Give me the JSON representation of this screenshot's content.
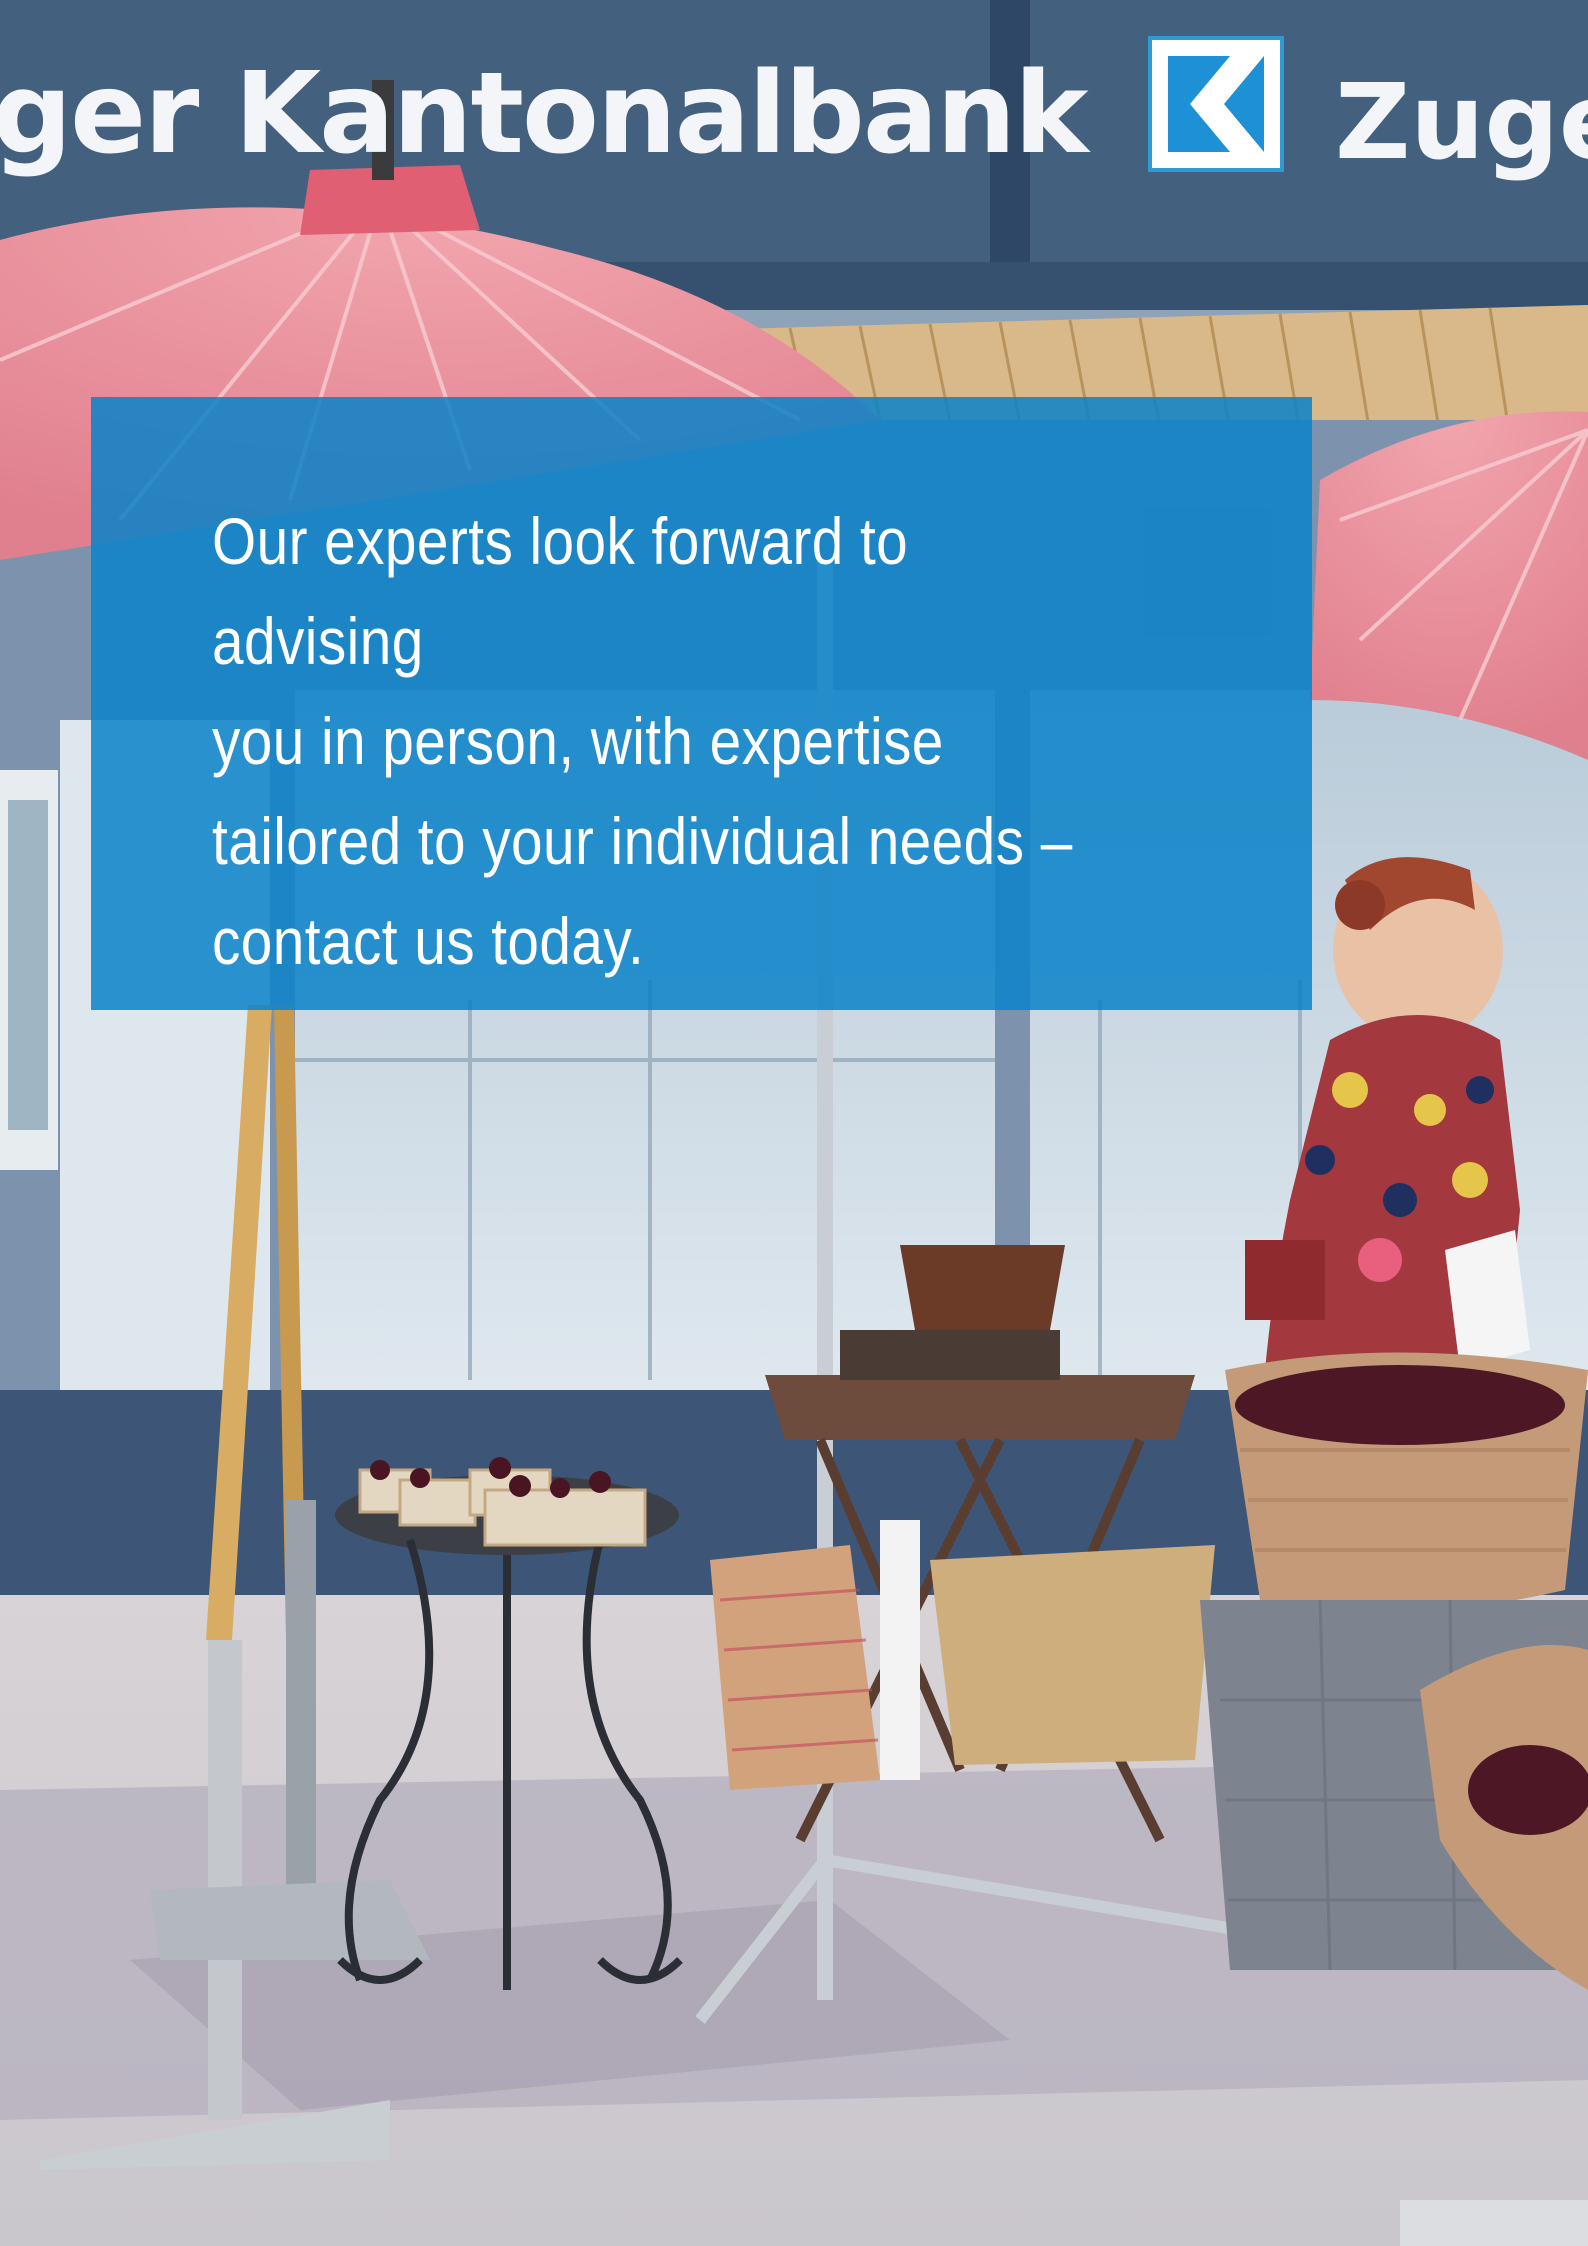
{
  "signage": {
    "left_text": "ger Kantonalbank",
    "right_text": "Zuge"
  },
  "callout": {
    "text": "Our experts look forward to advising\nyou in person, with expertise\ntailored to your individual needs –\ncontact us today."
  },
  "colors": {
    "callout_blue": "#0a82c8",
    "facade_blue": "#3d5678",
    "parasol_pink": "#e98a96",
    "brand_blue": "#1e90d6"
  }
}
